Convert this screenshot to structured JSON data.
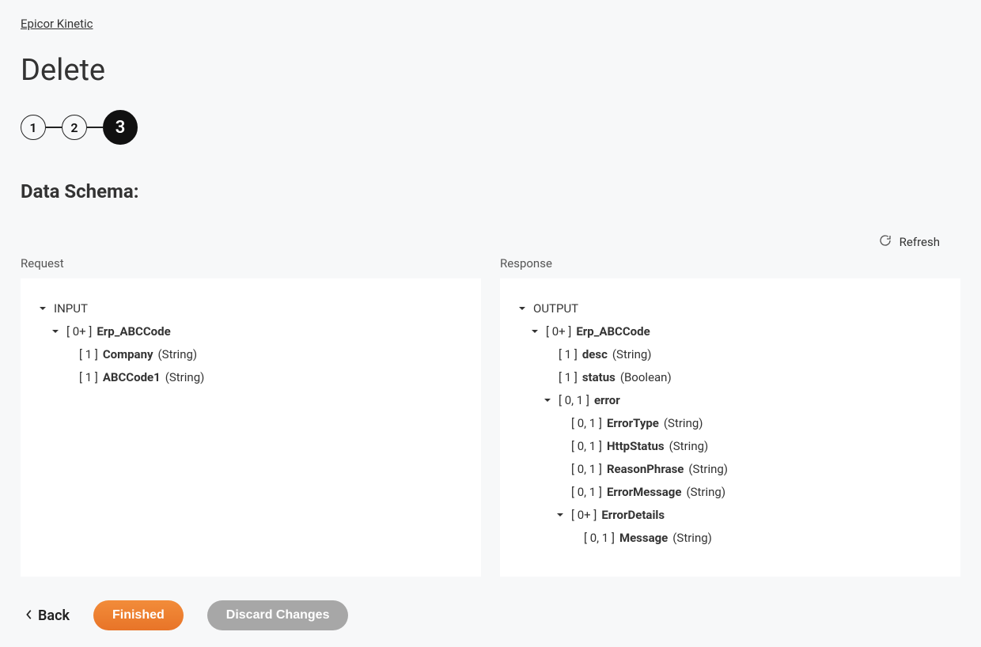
{
  "breadcrumb": "Epicor Kinetic",
  "page_title": "Delete",
  "stepper": {
    "steps": [
      "1",
      "2",
      "3"
    ],
    "active_index": 2
  },
  "section_title": "Data Schema:",
  "refresh_label": "Refresh",
  "request": {
    "label": "Request",
    "root": "INPUT",
    "tree": [
      {
        "level": 1,
        "chev": true,
        "card": "[ 0+ ]",
        "name": "Erp_ABCCode",
        "type": ""
      },
      {
        "level": 2,
        "chev": false,
        "card": "[ 1 ]",
        "name": "Company",
        "type": "(String)"
      },
      {
        "level": 2,
        "chev": false,
        "card": "[ 1 ]",
        "name": "ABCCode1",
        "type": "(String)"
      }
    ]
  },
  "response": {
    "label": "Response",
    "root": "OUTPUT",
    "tree": [
      {
        "level": 1,
        "chev": true,
        "card": "[ 0+ ]",
        "name": "Erp_ABCCode",
        "type": ""
      },
      {
        "level": 2,
        "chev": false,
        "card": "[ 1 ]",
        "name": "desc",
        "type": "(String)"
      },
      {
        "level": 2,
        "chev": false,
        "card": "[ 1 ]",
        "name": "status",
        "type": "(Boolean)"
      },
      {
        "level": 2,
        "chev": true,
        "card": "[ 0, 1 ]",
        "name": "error",
        "type": ""
      },
      {
        "level": 3,
        "chev": false,
        "card": "[ 0, 1 ]",
        "name": "ErrorType",
        "type": "(String)"
      },
      {
        "level": 3,
        "chev": false,
        "card": "[ 0, 1 ]",
        "name": "HttpStatus",
        "type": "(String)"
      },
      {
        "level": 3,
        "chev": false,
        "card": "[ 0, 1 ]",
        "name": "ReasonPhrase",
        "type": "(String)"
      },
      {
        "level": 3,
        "chev": false,
        "card": "[ 0, 1 ]",
        "name": "ErrorMessage",
        "type": "(String)"
      },
      {
        "level": 3,
        "chev": true,
        "card": "[ 0+ ]",
        "name": "ErrorDetails",
        "type": ""
      },
      {
        "level": 4,
        "chev": false,
        "card": "[ 0, 1 ]",
        "name": "Message",
        "type": "(String)"
      }
    ]
  },
  "footer": {
    "back": "Back",
    "finished": "Finished",
    "discard": "Discard Changes"
  }
}
